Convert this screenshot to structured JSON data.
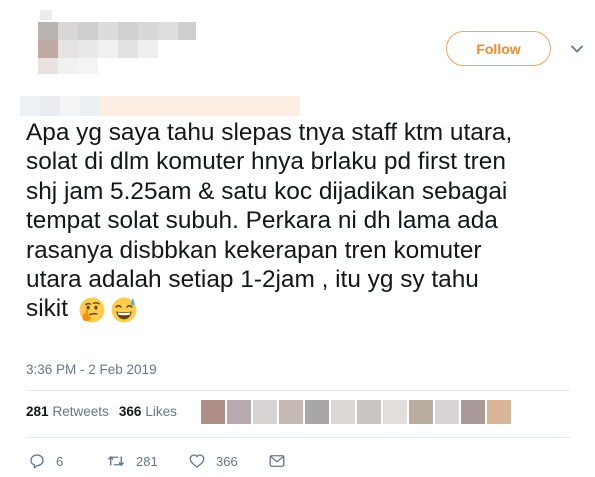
{
  "header": {
    "follow_label": "Follow",
    "chevron_icon": "chevron-down-icon",
    "accent_color": "#f08a2b"
  },
  "tweet": {
    "lines": [
      "Apa yg saya tahu slepas tnya staff ktm utara,",
      "solat di dlm komuter hnya brlaku pd first tren",
      "shj jam 5.25am & satu koc dijadikan sebagai",
      "tempat solat subuh. Perkara ni dh lama ada",
      "rasanya disbbkan kekerapan tren komuter",
      "utara adalah setiap 1-2jam , itu yg sy tahu",
      "sikit"
    ],
    "emojis": [
      "thinking-face-emoji",
      "grinning-sweat-emoji"
    ],
    "timestamp": "3:36 PM - 2 Feb 2019"
  },
  "stats": {
    "retweets_count": "281",
    "retweets_label": "Retweets",
    "likes_count": "366",
    "likes_label": "Likes"
  },
  "actions": {
    "reply_count": "6",
    "retweet_count": "281",
    "like_count": "366",
    "reply_icon": "reply-icon",
    "retweet_icon": "retweet-icon",
    "like_icon": "heart-icon",
    "dm_icon": "mail-icon"
  }
}
